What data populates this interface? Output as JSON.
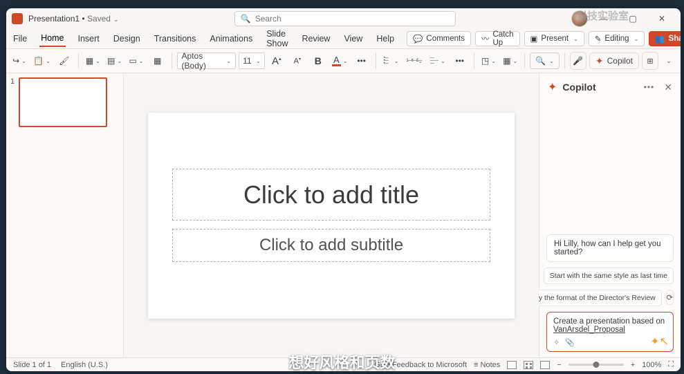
{
  "title": {
    "doc": "Presentation1",
    "status": "Saved"
  },
  "search": {
    "placeholder": "Search"
  },
  "menu": {
    "file": "File",
    "home": "Home",
    "insert": "Insert",
    "design": "Design",
    "transitions": "Transitions",
    "animations": "Animations",
    "slideshow": "Slide Show",
    "review": "Review",
    "view": "View",
    "help": "Help"
  },
  "actions": {
    "comments": "Comments",
    "catchup": "Catch Up",
    "present": "Present",
    "editing": "Editing",
    "share": "Share"
  },
  "ribbon": {
    "font_name": "Aptos (Body)",
    "font_size": "11",
    "copilot_label": "Copilot",
    "find_label": "Find"
  },
  "thumbs": {
    "n1": "1"
  },
  "slide": {
    "title_ph": "Click to add title",
    "subtitle_ph": "Click to add subtitle"
  },
  "copilot": {
    "title": "Copilot",
    "greeting": "Hi Lilly, how can I help get you started?",
    "sugg1": "Start with the same style as last time",
    "sugg2": "Copy the format of the Director's Review",
    "prompt_text": "Create a presentation based on",
    "prompt_link": "VanArsdel_Proposal"
  },
  "status": {
    "slide_of": "Slide 1 of 1",
    "lang": "English (U.S.)",
    "notes": "Notes",
    "feedback": "Give Feedback to Microsoft",
    "zoom": "100%"
  },
  "caption": "想好风格和页数",
  "watermark": "科技实验室"
}
